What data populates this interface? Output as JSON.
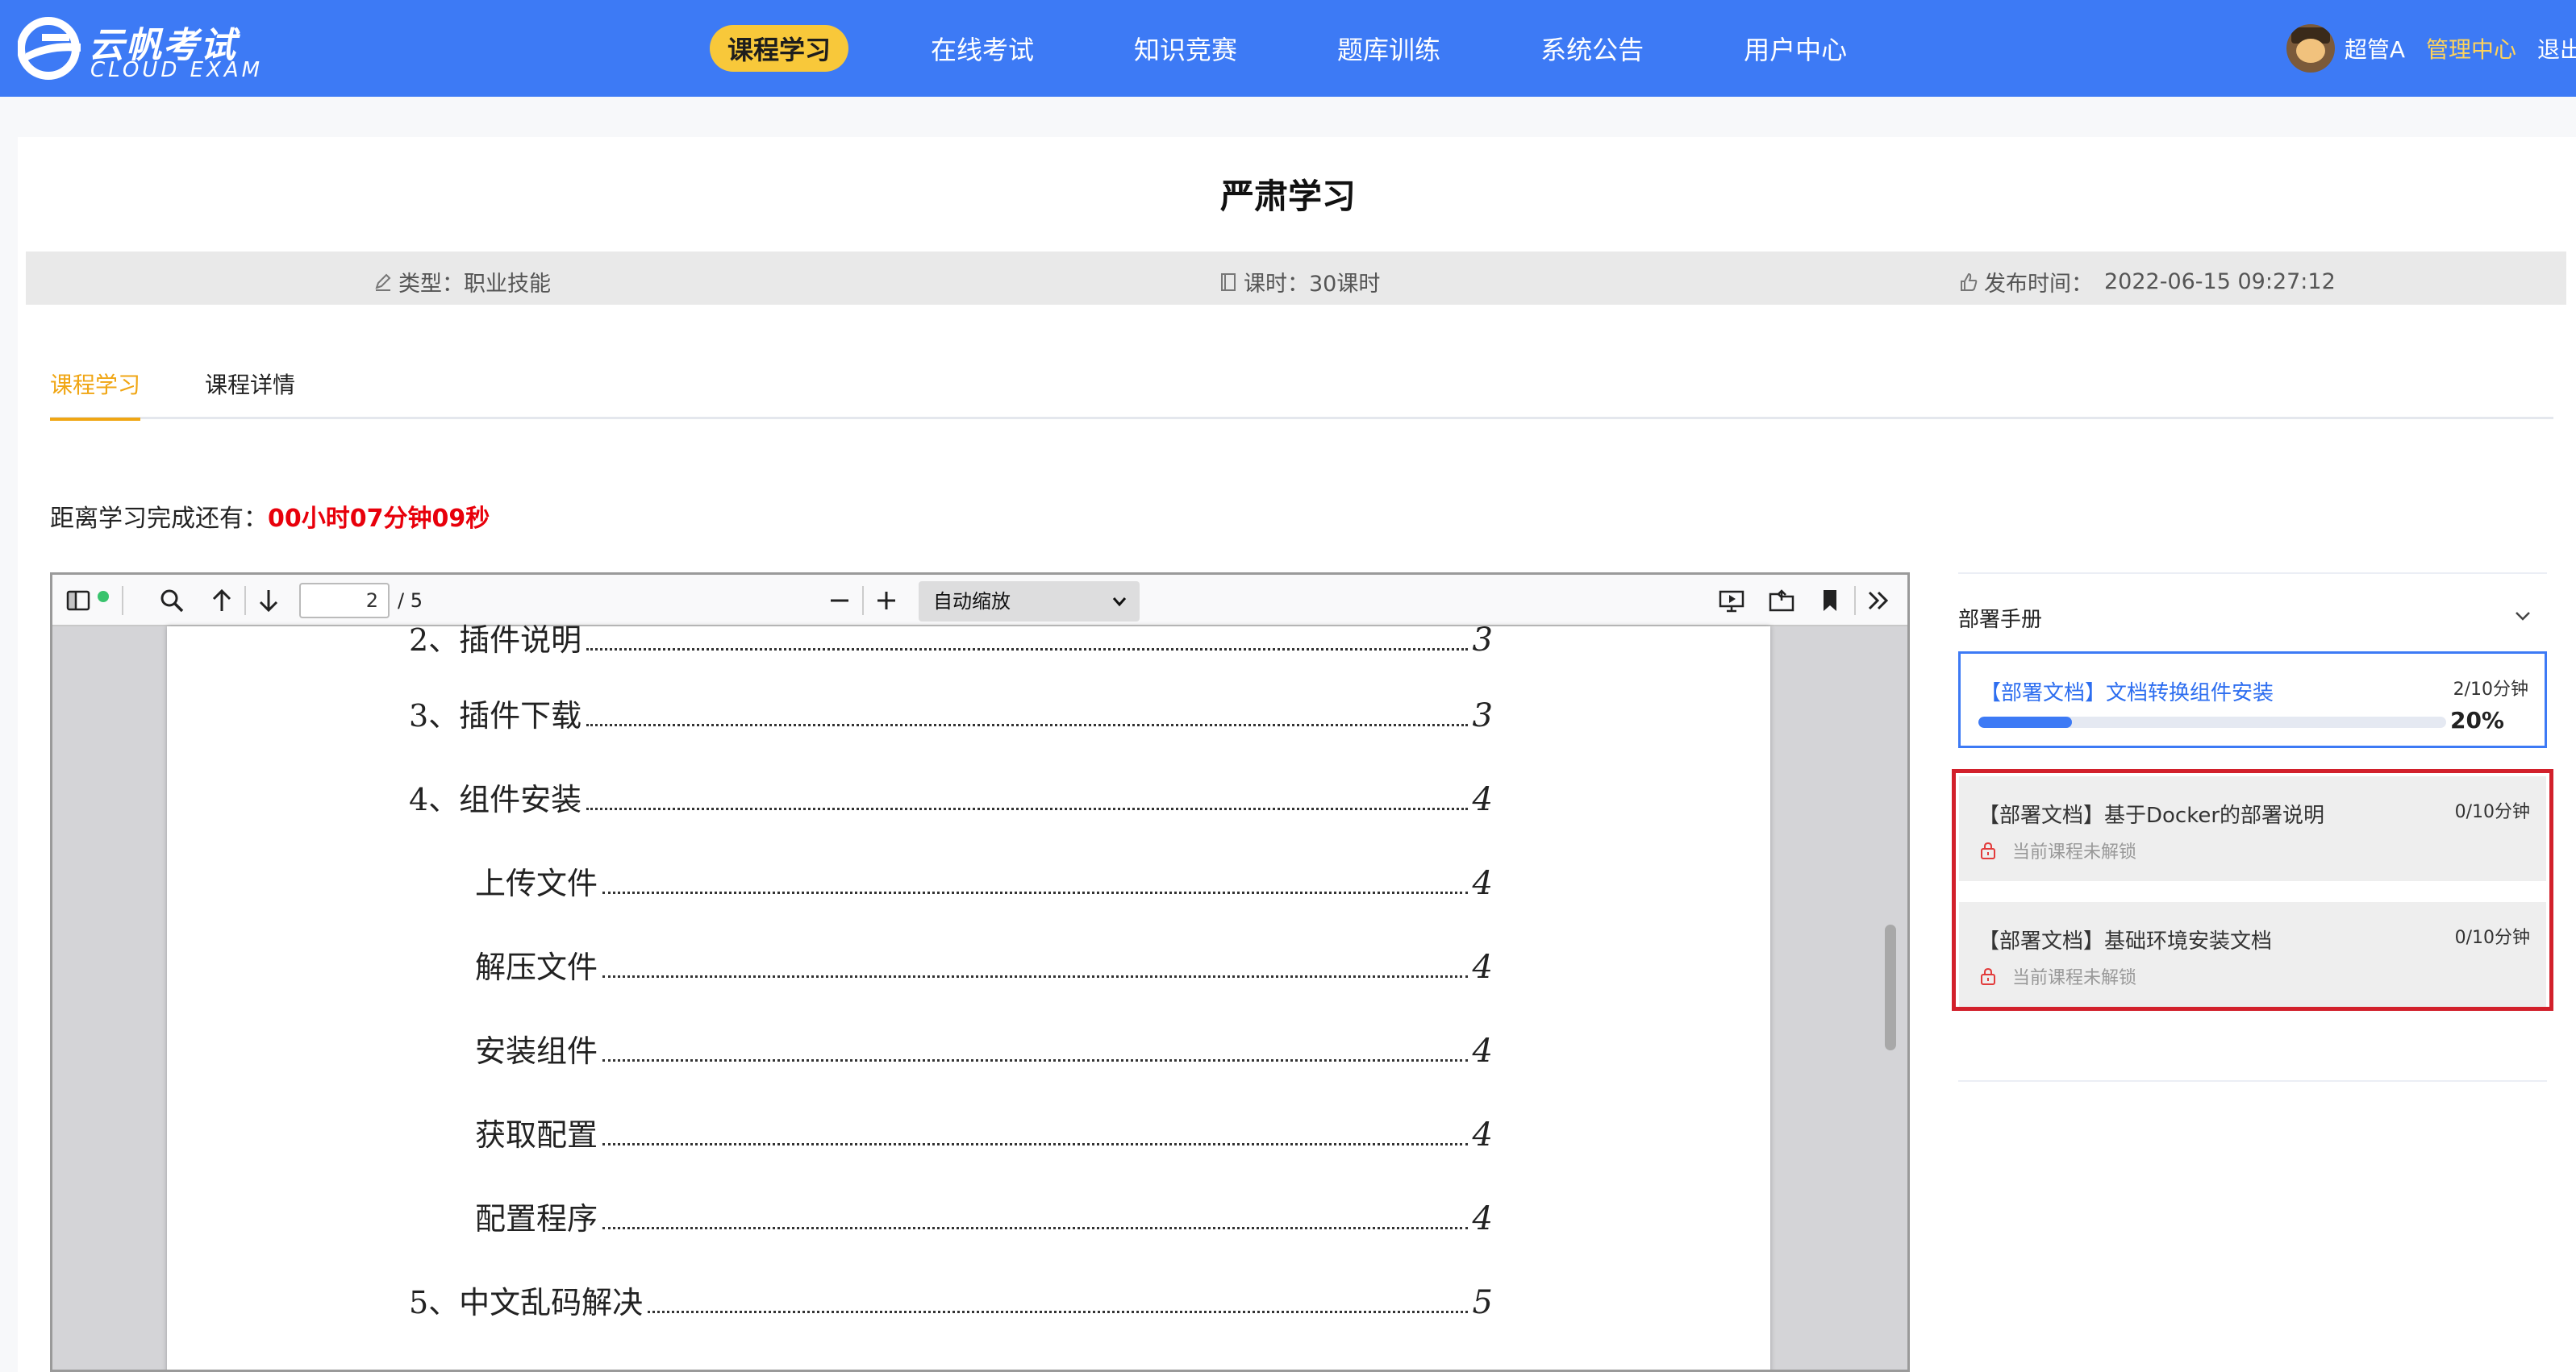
{
  "header": {
    "logo": {
      "cn": "云帆考试",
      "en": "CLOUD EXAM"
    },
    "nav": [
      "课程学习",
      "在线考试",
      "知识竞赛",
      "题库训练",
      "系统公告",
      "用户中心"
    ],
    "active_nav_index": 0,
    "user": {
      "name": "超管A",
      "admin_link": "管理中心",
      "logout": "退出"
    }
  },
  "course": {
    "title": "严肃学习",
    "meta": {
      "type_label": "类型：",
      "type_value": "职业技能",
      "hours_label": "课时：",
      "hours_value": "30课时",
      "publish_label": "发布时间：",
      "publish_value": "2022-06-15 09:27:12"
    },
    "tabs": [
      "课程学习",
      "课程详情"
    ],
    "active_tab_index": 0,
    "countdown_label": "距离学习完成还有：",
    "countdown_value": "00小时07分钟09秒"
  },
  "pdf": {
    "current_page": "2",
    "total_pages": "/ 5",
    "zoom": "自动缩放",
    "toc": [
      {
        "text": "2、插件说明",
        "page": "3"
      },
      {
        "text": "3、插件下载",
        "page": "3"
      },
      {
        "text": "4、组件安装",
        "page": "4"
      },
      {
        "text": "上传文件",
        "page": "4"
      },
      {
        "text": "解压文件",
        "page": "4"
      },
      {
        "text": "安装组件",
        "page": "4"
      },
      {
        "text": "获取配置",
        "page": "4"
      },
      {
        "text": "配置程序",
        "page": "4"
      },
      {
        "text": "5、中文乱码解决",
        "page": "5"
      }
    ]
  },
  "side": {
    "section_title": "部署手册",
    "docs": [
      {
        "title": "【部署文档】文档转换组件安装",
        "time": "2/10分钟",
        "progress": 20,
        "progress_label": "20%",
        "locked": false
      },
      {
        "title": "【部署文档】基于Docker的部署说明",
        "time": "0/10分钟",
        "lock_text": "当前课程未解锁",
        "locked": true
      },
      {
        "title": "【部署文档】基础环境安装文档",
        "time": "0/10分钟",
        "lock_text": "当前课程未解锁",
        "locked": true
      }
    ]
  },
  "colors": {
    "header_bg": "#3d7af5",
    "nav_active_bg": "#f8c83a",
    "admin_link": "#ffd35a",
    "tab_active": "#f0a614",
    "countdown": "#e8000b",
    "highlight_border": "#d2202b"
  }
}
